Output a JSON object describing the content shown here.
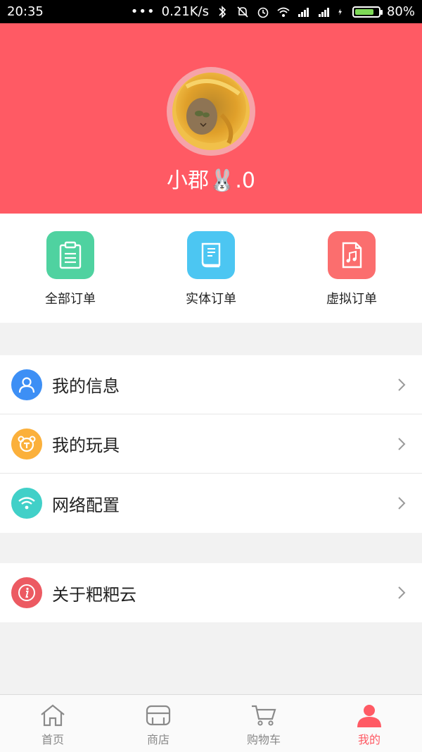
{
  "status_bar": {
    "time": "20:35",
    "network_speed": "0.21K/s",
    "battery_percent": "80%",
    "battery_level": 0.8,
    "icons": [
      "dots-icon",
      "bluetooth-icon",
      "mute-icon",
      "alarm-icon",
      "wifi-icon",
      "signal-icon",
      "signal-icon",
      "charging-icon",
      "battery-icon"
    ]
  },
  "profile": {
    "username": "小郡🐰.0"
  },
  "orders": [
    {
      "label": "全部订单",
      "icon": "clipboard-icon",
      "color": "#4fd2a0"
    },
    {
      "label": "实体订单",
      "icon": "book-icon",
      "color": "#4cc6f2"
    },
    {
      "label": "虚拟订单",
      "icon": "music-file-icon",
      "color": "#fb6e6e"
    }
  ],
  "menu_group_1": [
    {
      "label": "我的信息",
      "icon": "user-icon",
      "color": "#3d8ff5"
    },
    {
      "label": "我的玩具",
      "icon": "toy-bear-icon",
      "color": "#fbb03b"
    },
    {
      "label": "网络配置",
      "icon": "wifi-icon",
      "color": "#41d0c8"
    }
  ],
  "menu_group_2": [
    {
      "label": "关于粑粑云",
      "icon": "info-icon",
      "color": "#ec5a62"
    }
  ],
  "tabbar": [
    {
      "label": "首页",
      "icon": "home-icon",
      "active": false
    },
    {
      "label": "商店",
      "icon": "store-icon",
      "active": false
    },
    {
      "label": "购物车",
      "icon": "cart-icon",
      "active": false
    },
    {
      "label": "我的",
      "icon": "profile-icon",
      "active": true
    }
  ],
  "colors": {
    "accent": "#ff5a64",
    "background": "#f2f2f2"
  }
}
